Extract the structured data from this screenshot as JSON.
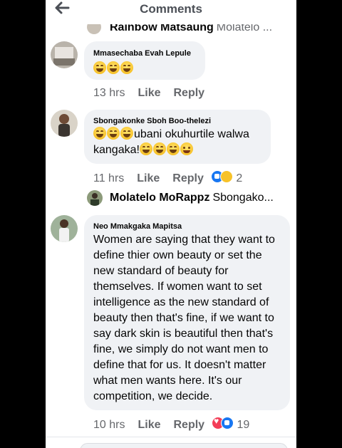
{
  "header": {
    "title": "Comments",
    "back_icon": "arrow-left-icon"
  },
  "cutoff_reply": {
    "name": "Rainbow Matsaung",
    "snippet": "Molatelo ..."
  },
  "comments": [
    {
      "author": "Mmasechaba Evah Lepule",
      "emoji": [
        "laugh-cry",
        "laugh-cry",
        "laugh-cry"
      ],
      "time": "13 hrs",
      "like": "Like",
      "reply": "Reply"
    },
    {
      "author": "Sbongakonke Sboh Boo-thelezi",
      "emoji_lead": [
        "laugh-cry",
        "laugh-cry",
        "rofl"
      ],
      "text_a": "ubani okuhurtile walwa",
      "text_b": "kangaka!",
      "emoji_tail": [
        "laugh-cry",
        "laugh-cry",
        "laugh-cry",
        "loud-cry"
      ],
      "time": "11 hrs",
      "like": "Like",
      "reply": "Reply",
      "reaction_count": "2",
      "reactions": [
        "like",
        "haha"
      ]
    },
    {
      "author": "Neo Mmakgaka Mapitsa",
      "text": "Women are saying that they want to define thier own beauty or set the new standard of beauty for themselves. If women want to set intelligence as the new standard of beauty then that's fine, if we want to say dark skin is beautiful then that's fine, we simply do not want men to define that for us. It doesn't matter what men wants here. It's our competition, we decide.",
      "time": "10 hrs",
      "like": "Like",
      "reply": "Reply",
      "reaction_count": "19",
      "reactions": [
        "love",
        "like"
      ]
    }
  ],
  "reply_preview": {
    "name": "Molatelo MoRappz",
    "snippet": "Sbongako..."
  },
  "colors": {
    "accent": "#1877f2",
    "bubble": "#f0f2f5",
    "meta": "#65676b"
  }
}
